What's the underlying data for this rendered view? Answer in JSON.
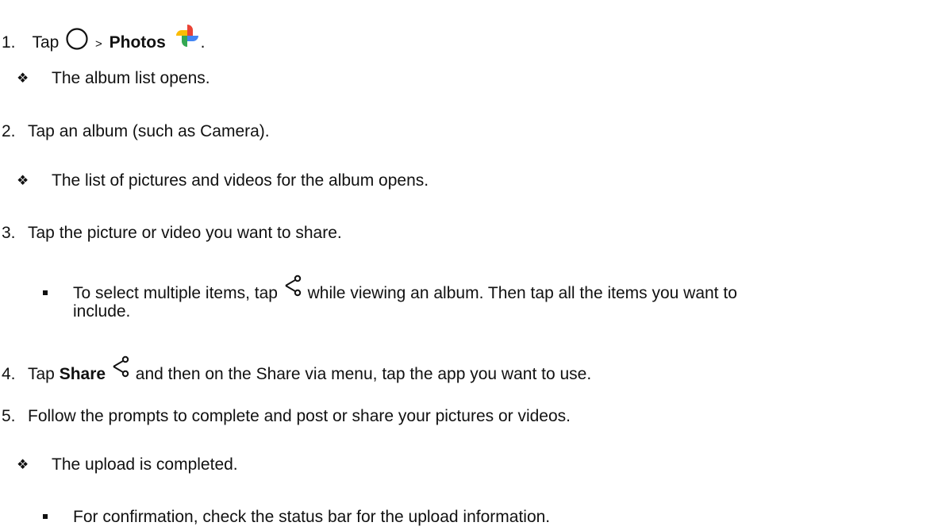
{
  "steps": [
    {
      "num": "1.",
      "pre": "Tap",
      "sep": ">",
      "bold": "Photos",
      "post": "."
    },
    {
      "num": "2.",
      "text": "Tap an album (such as Camera)."
    },
    {
      "num": "3.",
      "text": "Tap the picture or video you want to share."
    },
    {
      "num": "4.",
      "pre": "Tap",
      "bold": "Share",
      "post": "and then on the Share via menu, tap the app you want to use."
    },
    {
      "num": "5.",
      "text": "Follow the prompts to complete and post or share your pictures or videos."
    }
  ],
  "results": {
    "album_list": "The album list opens.",
    "pictures_list": "The list of pictures and videos for the album opens.",
    "upload_done": "The upload is completed."
  },
  "notes": {
    "multi_select_pre": "To select multiple items, tap",
    "multi_select_post": "while viewing an album. Then tap all the items you want to",
    "multi_select_cont": "include.",
    "confirmation": "For confirmation, check the status bar for the upload information."
  },
  "icons": {
    "home": "home-circle-icon",
    "photos": "google-photos-pinwheel-icon",
    "share": "share-icon"
  },
  "colors": {
    "text": "#111111",
    "photos_red": "#ea4335",
    "photos_yellow": "#fbbc05",
    "photos_green": "#34a853",
    "photos_blue": "#4285f4"
  }
}
